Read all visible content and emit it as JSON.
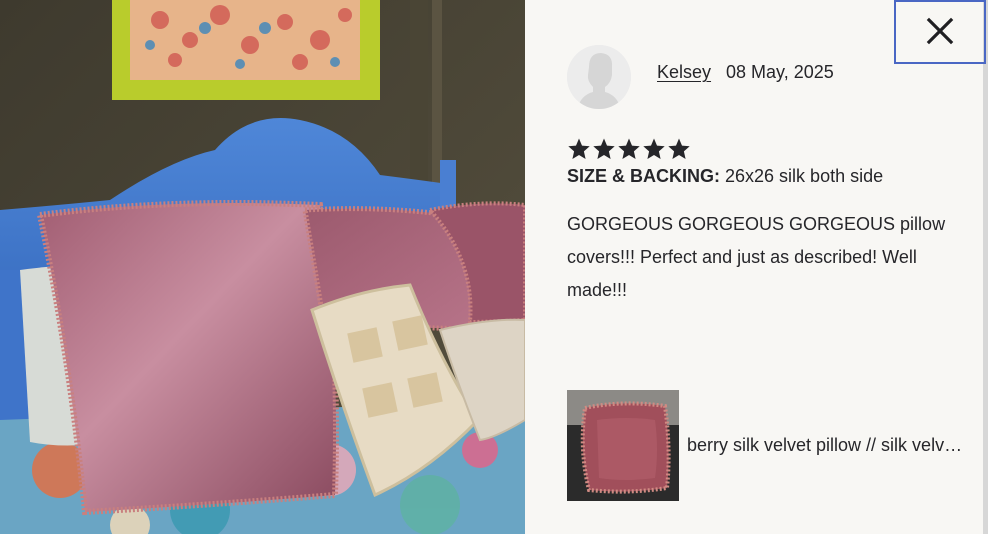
{
  "modal": {
    "close_icon": "close-icon",
    "photo_alt": "Review photo of pink silk velvet pillows on a blue bed"
  },
  "review": {
    "author": "Kelsey",
    "date": "08 May, 2025",
    "rating": 5,
    "rating_max": 5,
    "size_label": "SIZE & BACKING:",
    "size_value": "26x26 silk both side",
    "body": "GORGEOUS GORGEOUS GORGEOUS pillow covers!!! Perfect and just as described! Well made!!!"
  },
  "product": {
    "name": "berry silk velvet pillow // silk velvet pillow cover"
  },
  "colors": {
    "star": "#26262a",
    "focus_ring": "#4a67c4",
    "panel_bg": "#f8f7f4",
    "text": "#26262a"
  }
}
